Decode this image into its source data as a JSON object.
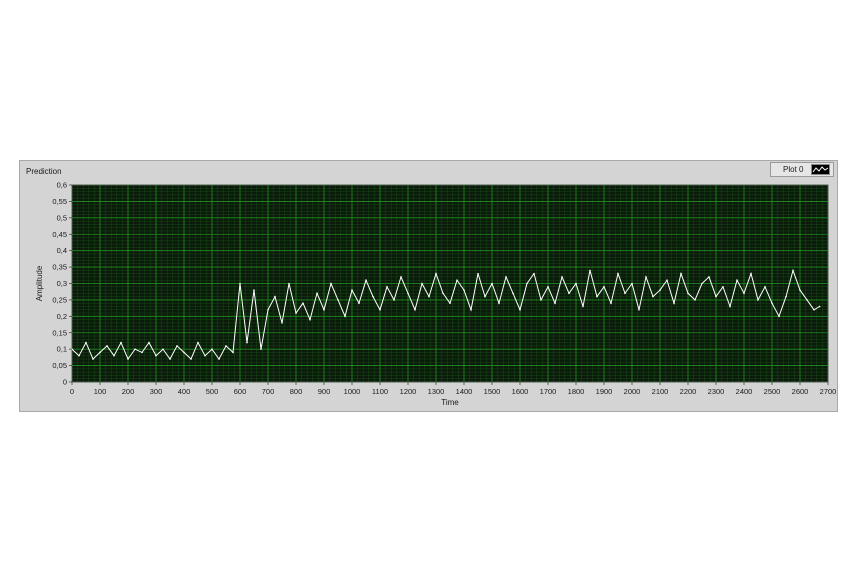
{
  "graph": {
    "title": "Prediction",
    "legend_label": "Plot 0"
  },
  "chart_data": {
    "type": "line",
    "title": "Prediction",
    "xlabel": "Time",
    "ylabel": "Amplitude",
    "xlim": [
      0,
      2700
    ],
    "ylim": [
      0,
      0.6
    ],
    "grid": true,
    "legend_position": "top-right",
    "x_ticks": [
      "0",
      "100",
      "200",
      "300",
      "400",
      "500",
      "600",
      "700",
      "800",
      "900",
      "1000",
      "1100",
      "1200",
      "1300",
      "1400",
      "1500",
      "1600",
      "1700",
      "1800",
      "1900",
      "2000",
      "2100",
      "2200",
      "2300",
      "2400",
      "2500",
      "2600",
      "2700"
    ],
    "y_ticks": [
      "0",
      "0,05",
      "0,1",
      "0,15",
      "0,2",
      "0,25",
      "0,3",
      "0,35",
      "0,4",
      "0,45",
      "0,5",
      "0,55",
      "0,6"
    ],
    "colors": {
      "plot_background": "#0b1a0b",
      "major_grid": "#1f8f1f",
      "minor_grid": "#164a16",
      "line": "#ffffff"
    },
    "series": [
      {
        "name": "Plot 0",
        "x": [
          0,
          25,
          50,
          75,
          100,
          125,
          150,
          175,
          200,
          225,
          250,
          275,
          300,
          325,
          350,
          375,
          400,
          425,
          450,
          475,
          500,
          525,
          550,
          575,
          600,
          625,
          650,
          675,
          700,
          725,
          750,
          775,
          800,
          825,
          850,
          875,
          900,
          925,
          950,
          975,
          1000,
          1025,
          1050,
          1075,
          1100,
          1125,
          1150,
          1175,
          1200,
          1225,
          1250,
          1275,
          1300,
          1325,
          1350,
          1375,
          1400,
          1425,
          1450,
          1475,
          1500,
          1525,
          1550,
          1575,
          1600,
          1625,
          1650,
          1675,
          1700,
          1725,
          1750,
          1775,
          1800,
          1825,
          1850,
          1875,
          1900,
          1925,
          1950,
          1975,
          2000,
          2025,
          2050,
          2075,
          2100,
          2125,
          2150,
          2175,
          2200,
          2225,
          2250,
          2275,
          2300,
          2325,
          2350,
          2375,
          2400,
          2425,
          2450,
          2475,
          2500,
          2525,
          2550,
          2575,
          2600,
          2625,
          2650,
          2670
        ],
        "y": [
          0.1,
          0.08,
          0.12,
          0.07,
          0.09,
          0.11,
          0.08,
          0.12,
          0.07,
          0.1,
          0.09,
          0.12,
          0.08,
          0.1,
          0.07,
          0.11,
          0.09,
          0.07,
          0.12,
          0.08,
          0.1,
          0.07,
          0.11,
          0.09,
          0.3,
          0.12,
          0.28,
          0.1,
          0.22,
          0.26,
          0.18,
          0.3,
          0.21,
          0.24,
          0.19,
          0.27,
          0.22,
          0.3,
          0.25,
          0.2,
          0.28,
          0.24,
          0.31,
          0.26,
          0.22,
          0.29,
          0.25,
          0.32,
          0.27,
          0.22,
          0.3,
          0.26,
          0.33,
          0.27,
          0.24,
          0.31,
          0.28,
          0.22,
          0.33,
          0.26,
          0.3,
          0.24,
          0.32,
          0.27,
          0.22,
          0.3,
          0.33,
          0.25,
          0.29,
          0.24,
          0.32,
          0.27,
          0.3,
          0.23,
          0.34,
          0.26,
          0.29,
          0.24,
          0.33,
          0.27,
          0.3,
          0.22,
          0.32,
          0.26,
          0.28,
          0.31,
          0.24,
          0.33,
          0.27,
          0.25,
          0.3,
          0.32,
          0.26,
          0.29,
          0.23,
          0.31,
          0.27,
          0.33,
          0.25,
          0.29,
          0.24,
          0.2,
          0.26,
          0.34,
          0.28,
          0.25,
          0.22,
          0.23
        ]
      }
    ]
  }
}
